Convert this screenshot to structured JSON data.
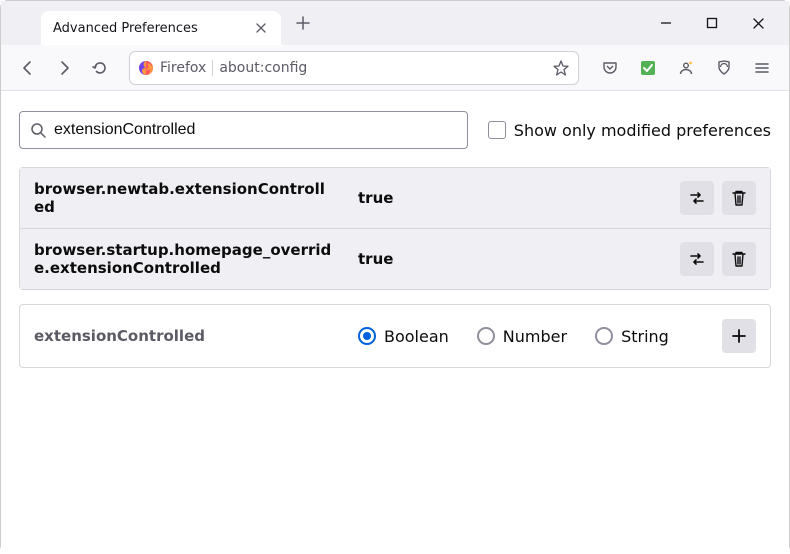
{
  "window": {
    "tab_title": "Advanced Preferences"
  },
  "urlbar": {
    "identity": "Firefox",
    "url": "about:config"
  },
  "search": {
    "value": "extensionControlled",
    "checkbox_label": "Show only modified preferences"
  },
  "prefs": [
    {
      "name": "browser.newtab.extensionControlled",
      "value": "true"
    },
    {
      "name": "browser.startup.homepage_override.extensionControlled",
      "value": "true"
    }
  ],
  "new_pref": {
    "name": "extensionControlled",
    "types": [
      "Boolean",
      "Number",
      "String"
    ],
    "selected": "Boolean"
  }
}
